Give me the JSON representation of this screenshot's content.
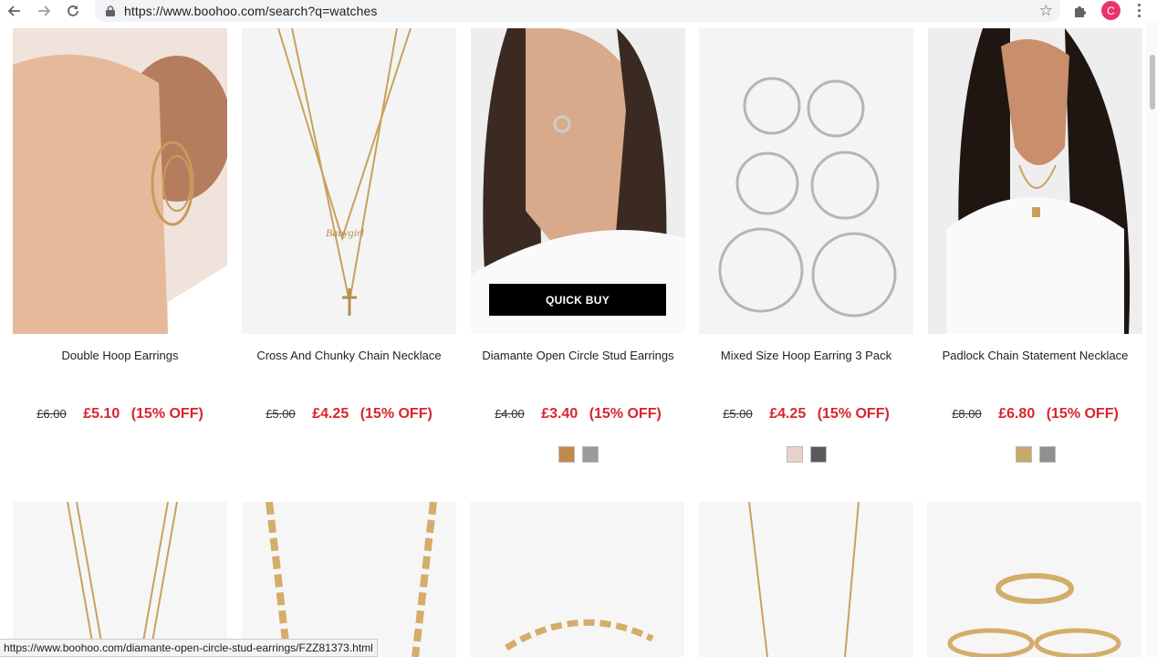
{
  "browser": {
    "url": "https://www.boohoo.com/search?q=watches",
    "avatar_letter": "C",
    "status_url": "https://www.boohoo.com/diamante-open-circle-stud-earrings/FZZ81373.html"
  },
  "products": [
    {
      "title": "Double Hoop Earrings",
      "old_price": "£6.00",
      "new_price": "£5.10",
      "discount": "(15% OFF)",
      "swatches": []
    },
    {
      "title": "Cross And Chunky Chain Necklace",
      "old_price": "£5.00",
      "new_price": "£4.25",
      "discount": "(15% OFF)",
      "swatches": []
    },
    {
      "title": "Diamante Open Circle Stud Earrings",
      "old_price": "£4.00",
      "new_price": "£3.40",
      "discount": "(15% OFF)",
      "swatches": [
        "#c08a4b",
        "#9a9a9a"
      ],
      "quick_buy": "QUICK BUY"
    },
    {
      "title": "Mixed Size Hoop Earring 3 Pack",
      "old_price": "£5.00",
      "new_price": "£4.25",
      "discount": "(15% OFF)",
      "swatches": [
        "#ead2c8",
        "#5a5a5a"
      ]
    },
    {
      "title": "Padlock Chain Statement Necklace",
      "old_price": "£8.00",
      "new_price": "£6.80",
      "discount": "(15% OFF)",
      "swatches": [
        "#c9a96a",
        "#8f8f8f"
      ]
    }
  ],
  "icons": {
    "back": "arrow-left-icon",
    "forward": "arrow-right-icon",
    "reload": "reload-icon",
    "lock": "lock-icon",
    "star": "star-icon",
    "extensions": "puzzle-icon",
    "menu": "kebab-menu-icon"
  }
}
